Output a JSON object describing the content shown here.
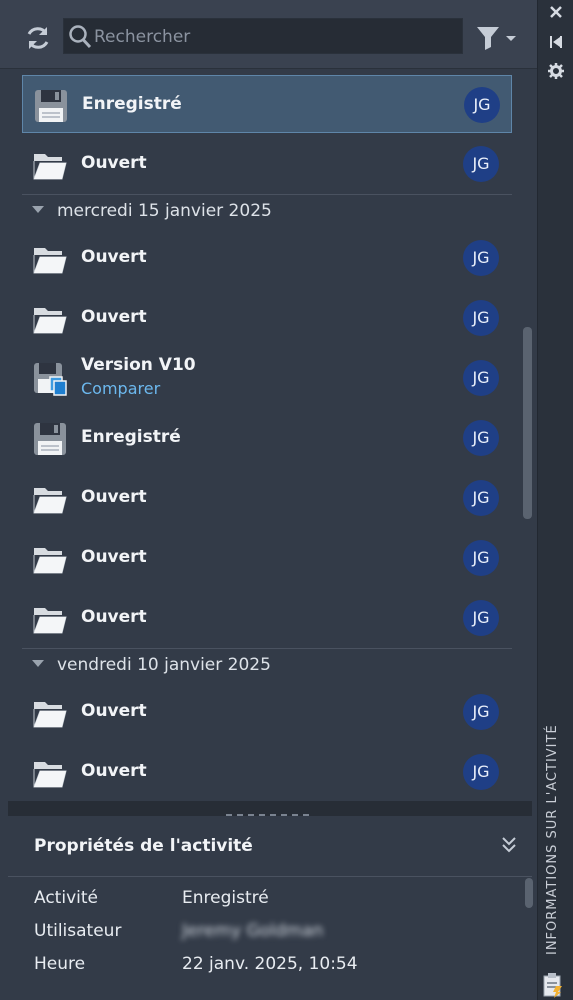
{
  "toolbar": {
    "search_placeholder": "Rechercher",
    "refresh_icon": "refresh-icon",
    "filter_icon": "filter-icon"
  },
  "activities": [
    {
      "icon": "save-icon",
      "label": "Enregistré",
      "user": "JG",
      "selected": true
    },
    {
      "icon": "folder-open-icon",
      "label": "Ouvert",
      "user": "JG"
    }
  ],
  "groups": [
    {
      "date": "mercredi 15 janvier 2025",
      "items": [
        {
          "icon": "folder-open-icon",
          "label": "Ouvert",
          "user": "JG"
        },
        {
          "icon": "folder-open-icon",
          "label": "Ouvert",
          "user": "JG"
        },
        {
          "icon": "version-icon",
          "label": "Version V10",
          "link": "Comparer",
          "user": "JG"
        },
        {
          "icon": "save-icon",
          "label": "Enregistré",
          "user": "JG"
        },
        {
          "icon": "folder-open-icon",
          "label": "Ouvert",
          "user": "JG"
        },
        {
          "icon": "folder-open-icon",
          "label": "Ouvert",
          "user": "JG"
        },
        {
          "icon": "folder-open-icon",
          "label": "Ouvert",
          "user": "JG"
        }
      ]
    },
    {
      "date": "vendredi 10 janvier 2025",
      "items": [
        {
          "icon": "folder-open-icon",
          "label": "Ouvert",
          "user": "JG"
        },
        {
          "icon": "folder-open-icon",
          "label": "Ouvert",
          "user": "JG"
        }
      ]
    }
  ],
  "properties": {
    "title": "Propriétés de l'activité",
    "rows": [
      {
        "key": "Activité",
        "value": "Enregistré"
      },
      {
        "key": "Utilisateur",
        "value": "Jeremy Goldman"
      },
      {
        "key": "Heure",
        "value": "22 janv. 2025, 10:54"
      }
    ]
  },
  "sidebar": {
    "title": "INFORMATIONS SUR L'ACTIVITÉ",
    "close_icon": "close-icon",
    "pin_icon": "pin-icon",
    "settings_icon": "settings-icon",
    "clipboard_icon": "clipboard-icon"
  },
  "colors": {
    "accent_link": "#6cb8ee",
    "selection": "#425a72",
    "avatar": "#1f3f86"
  }
}
